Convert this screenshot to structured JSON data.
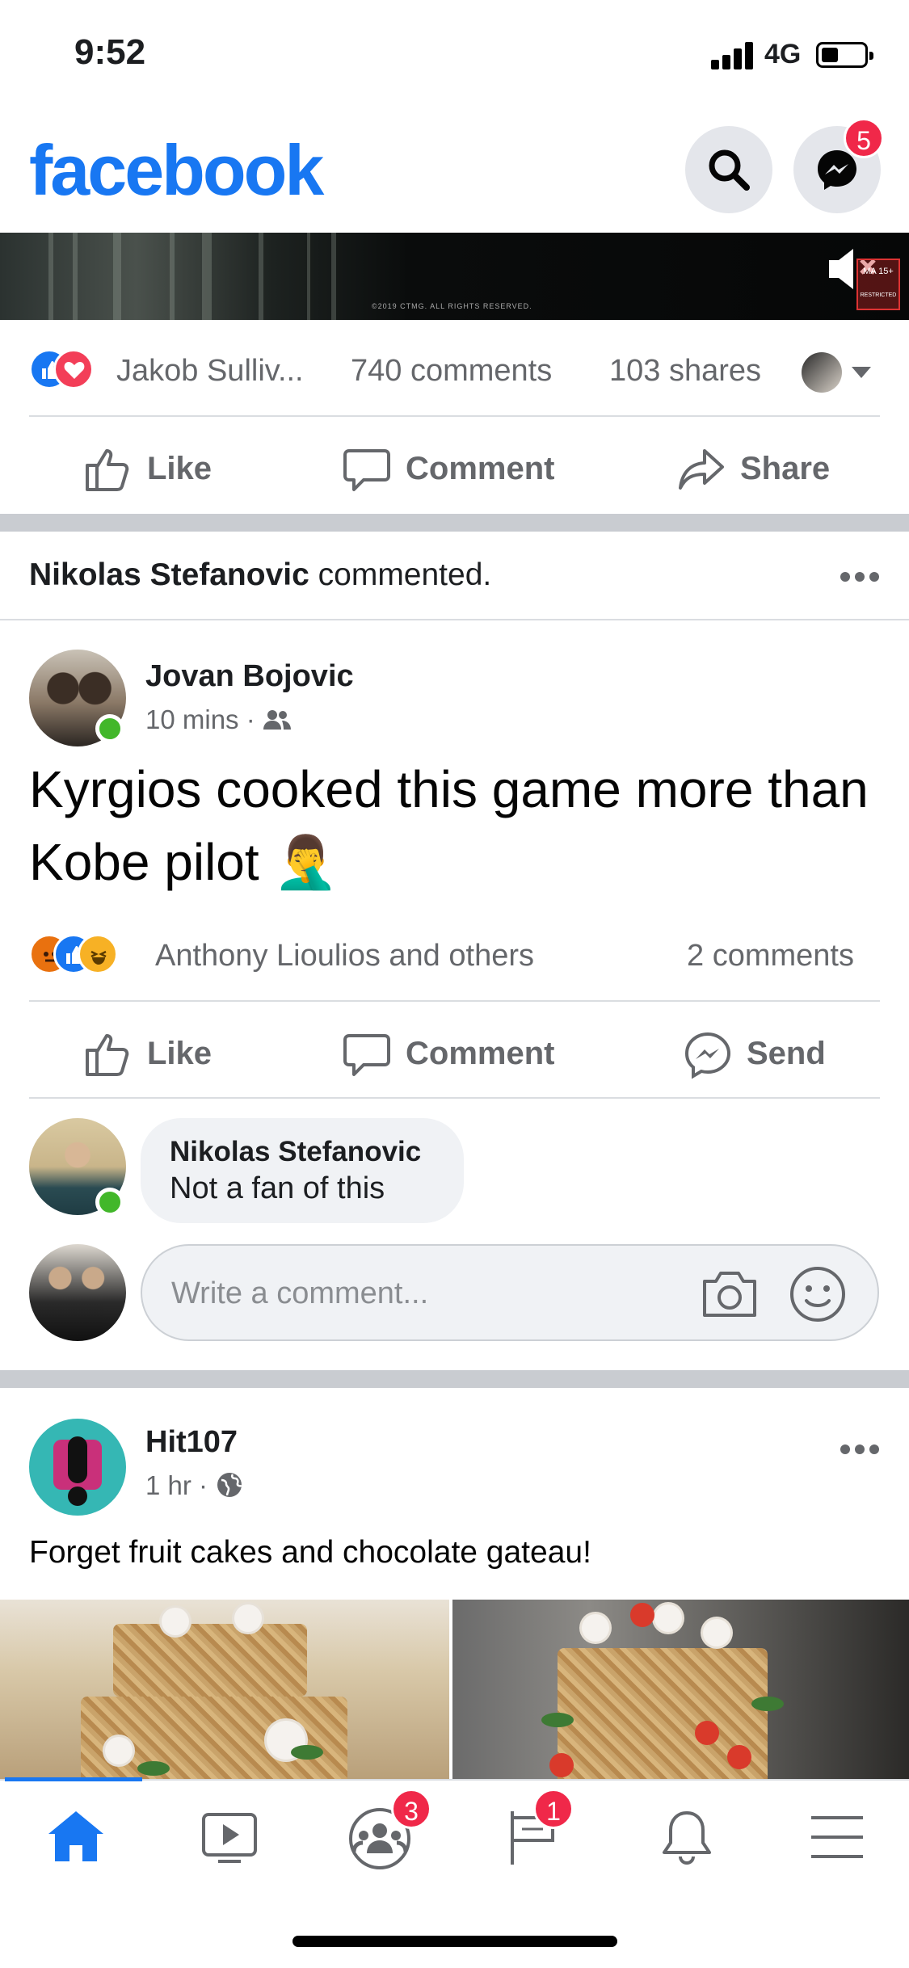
{
  "status_bar": {
    "time": "9:52",
    "network": "4G"
  },
  "header": {
    "logo": "facebook",
    "messenger_badge": "5",
    "icons": [
      "search-icon",
      "messenger-icon"
    ]
  },
  "video_ad": {
    "copyright": "©2019 CTMG. ALL RIGHTS RESERVED.",
    "rating_label": "MA 15+",
    "rating_sub": "RESTRICTED"
  },
  "post1_summary": {
    "reactions_by": "Jakob Sulliv...",
    "comments": "740 comments",
    "shares": "103 shares"
  },
  "post1_actions": {
    "like": "Like",
    "comment": "Comment",
    "share": "Share"
  },
  "story": {
    "actor": "Nikolas Stefanovic",
    "verb": "commented."
  },
  "post2": {
    "author": "Jovan Bojovic",
    "time": "10 mins",
    "text": "Kyrgios cooked this game more than Kobe pilot 🤦‍♂️",
    "reactions_by": "Anthony Lioulios and others",
    "comments": "2 comments",
    "actions": {
      "like": "Like",
      "comment": "Comment",
      "send": "Send"
    }
  },
  "top_comment": {
    "author": "Nikolas Stefanovic",
    "text": "Not a fan of this"
  },
  "comment_box": {
    "placeholder": "Write a comment..."
  },
  "post3": {
    "author": "Hit107",
    "time": "1 hr",
    "text": "Forget fruit cakes and chocolate gateau!"
  },
  "tabs": {
    "groups_badge": "3",
    "pages_badge": "1",
    "active": "home"
  },
  "colors": {
    "brand": "#1877f2",
    "badge": "#f02849",
    "online": "#42b72a"
  }
}
